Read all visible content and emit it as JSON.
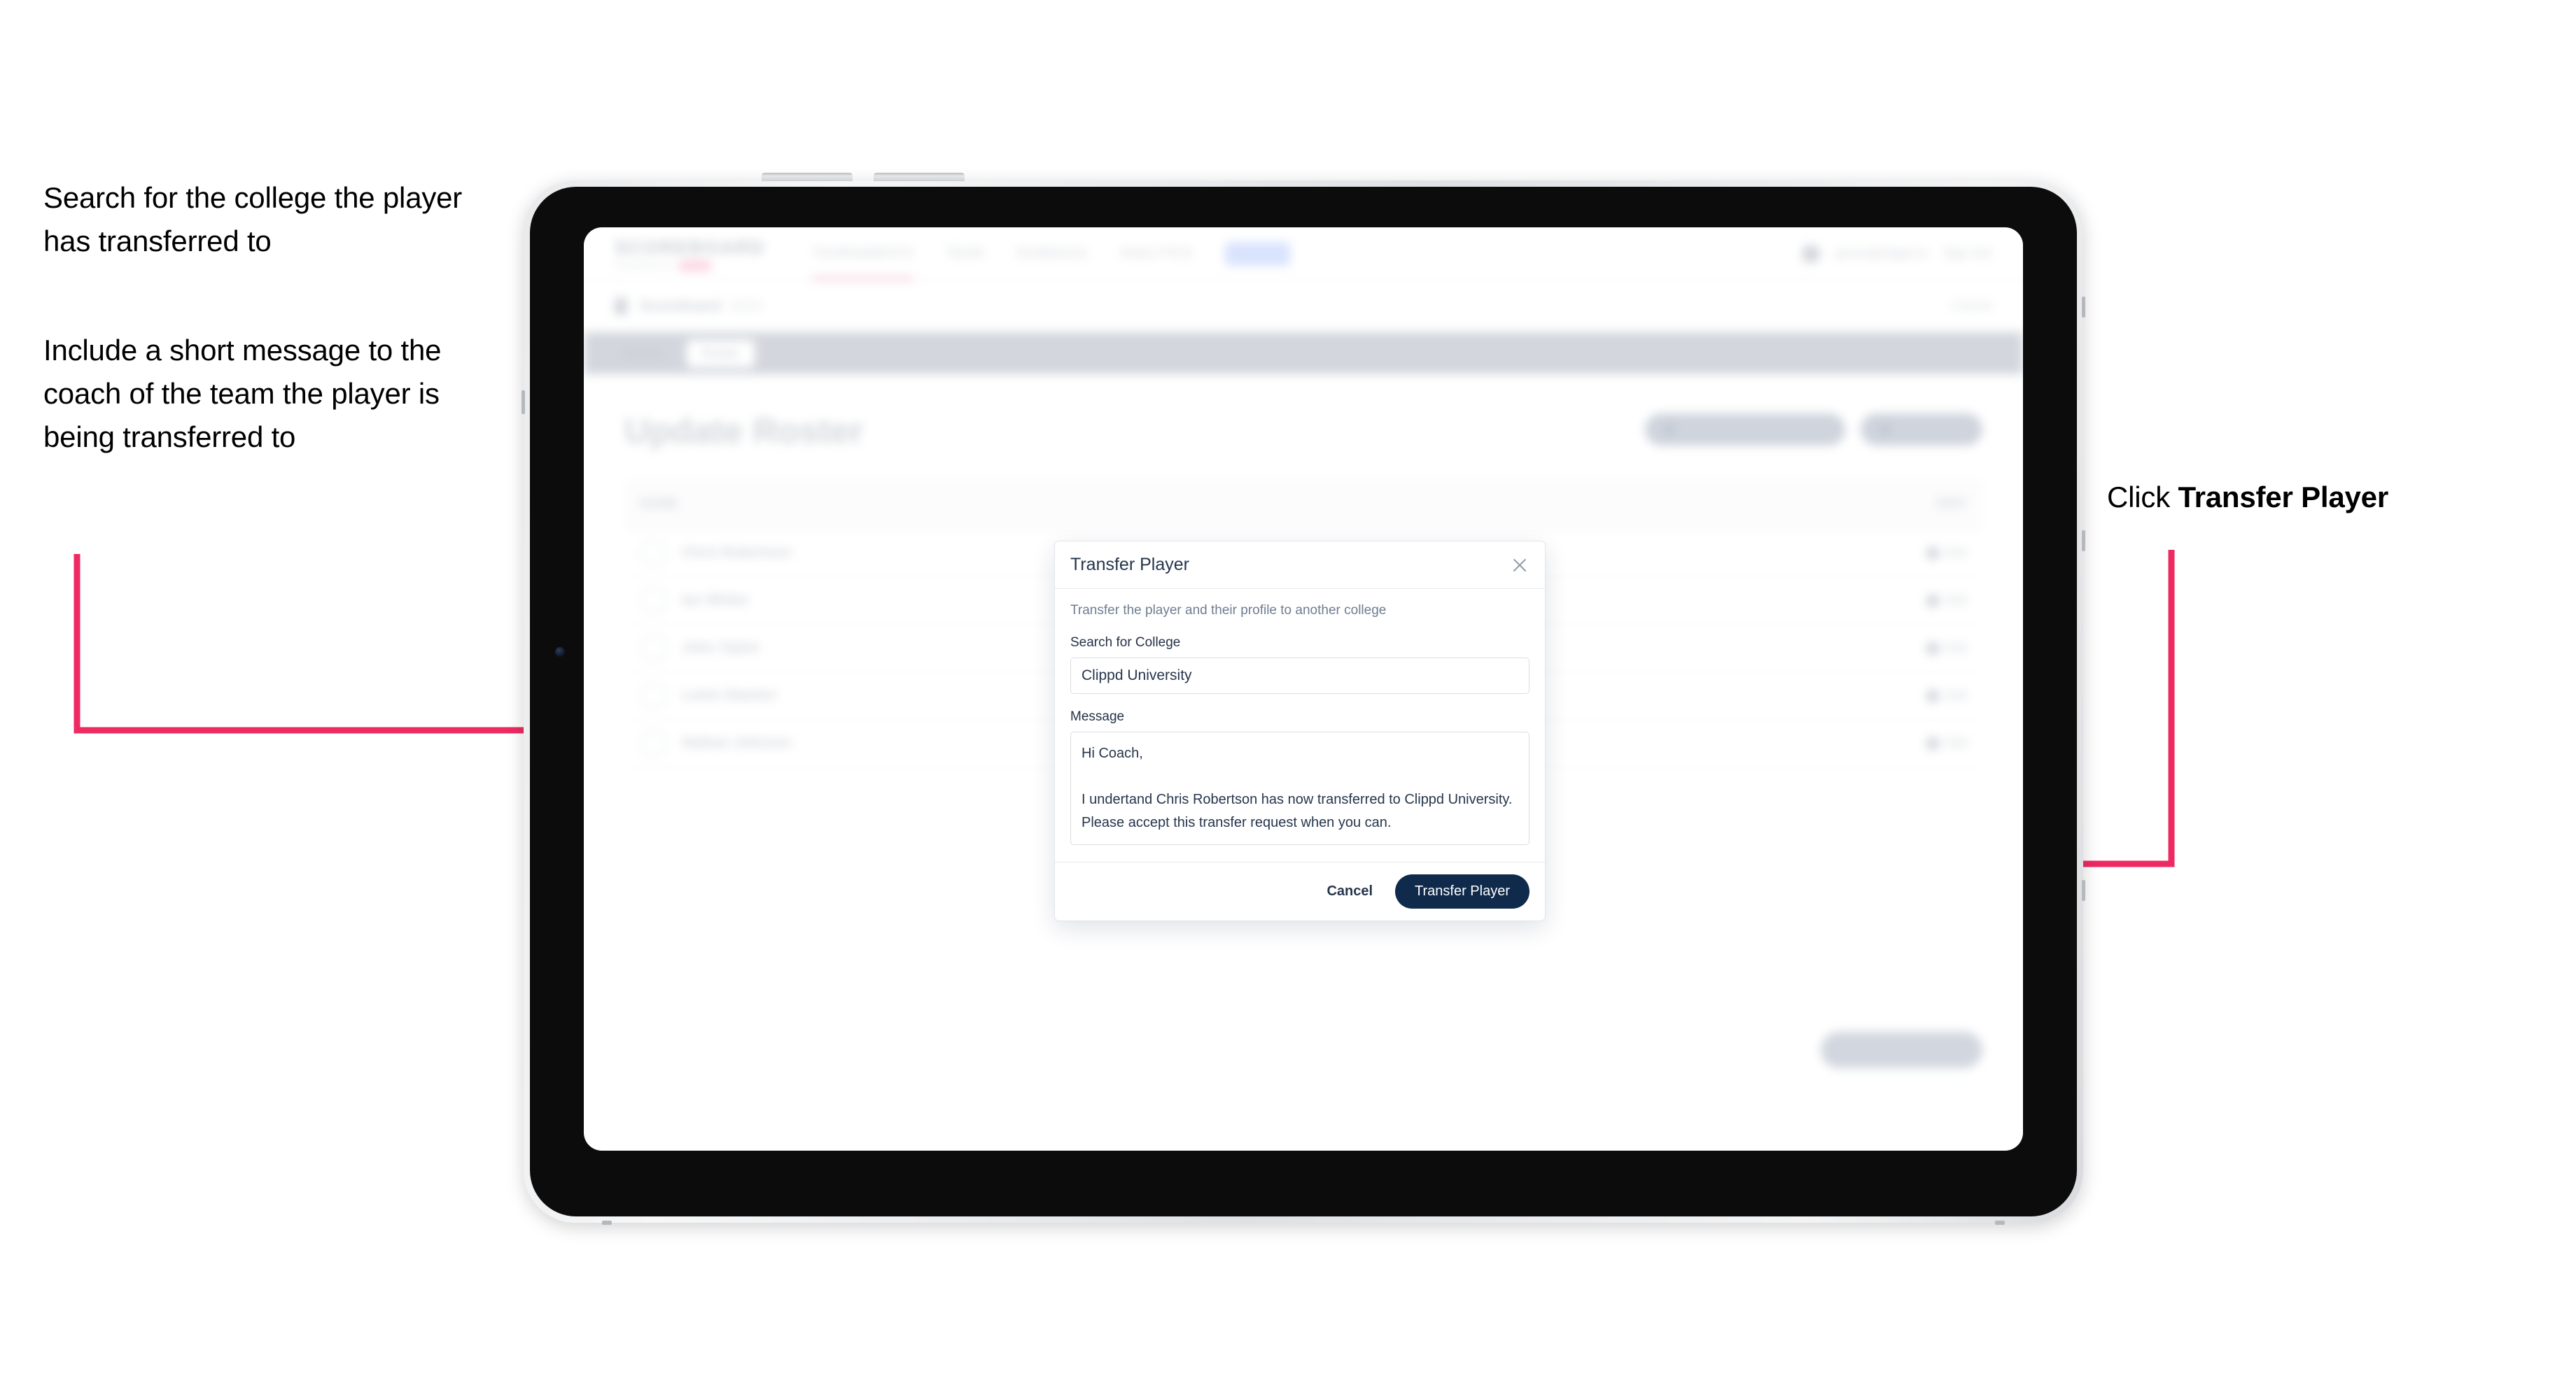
{
  "annotations": {
    "left_1": "Search for the college the player has transferred to",
    "left_2": "Include a short message to the coach of the team the player is being transferred to",
    "right_prefix": "Click ",
    "right_strong": "Transfer Player"
  },
  "app": {
    "brand": {
      "word": "SCOREBOARD",
      "sub": "POWERED BY",
      "badge": "clippd"
    },
    "nav": [
      {
        "label": "TOURNAMENTS",
        "active": true
      },
      {
        "label": "TEAM",
        "active": false
      },
      {
        "label": "SCHEDULE",
        "active": false
      },
      {
        "label": "ANALYTICS",
        "active": false
      }
    ],
    "nav_pill": "MORE",
    "topbar_right": {
      "account": "james@clippd.io",
      "sign_out": "Sign Out"
    },
    "breadcrumb": {
      "main": "Scoreboard",
      "sub": "2024",
      "right": "Cancel"
    },
    "tabs": [
      {
        "label": "Details",
        "selected": false
      },
      {
        "label": "Roster",
        "selected": true
      }
    ],
    "page_title": "Update Roster",
    "header_actions": [
      "Request Player Transfer",
      "Add Player"
    ],
    "table": {
      "columns": {
        "name": "NAME",
        "edit": "EDIT"
      },
      "rows": [
        {
          "name": "Chris Robertson",
          "edit": "Edit"
        },
        {
          "name": "Ian Winter",
          "edit": "Edit"
        },
        {
          "name": "John Taylor",
          "edit": "Edit"
        },
        {
          "name": "Lewis Stanton",
          "edit": "Edit"
        },
        {
          "name": "Nathan Johnson",
          "edit": "Edit"
        }
      ]
    },
    "bottom_action": "Save And Continue"
  },
  "modal": {
    "title": "Transfer Player",
    "description": "Transfer the player and their profile to another college",
    "college_label": "Search for College",
    "college_value": "Clippd University",
    "college_placeholder": "Search for College",
    "message_label": "Message",
    "message_value": "Hi Coach,\n\nI undertand Chris Robertson has now transferred to Clippd University. Please accept this transfer request when you can.",
    "cancel_label": "Cancel",
    "transfer_label": "Transfer Player"
  },
  "colors": {
    "accent_pink": "#ee2a62",
    "primary_navy": "#102a4c",
    "text_dark": "#26354c"
  }
}
